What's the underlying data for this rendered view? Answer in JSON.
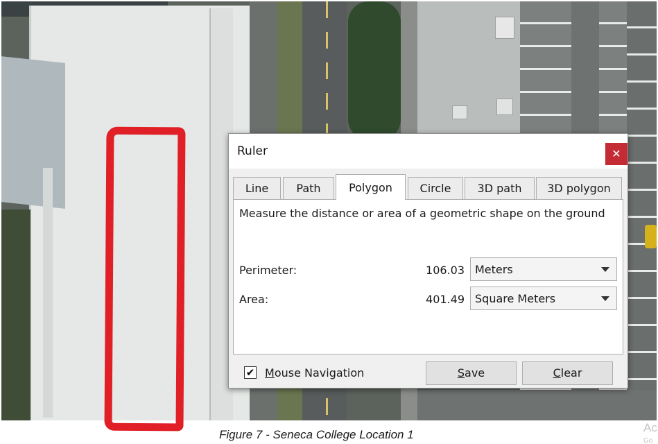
{
  "dialog": {
    "title": "Ruler",
    "close_glyph": "✕"
  },
  "tabs": [
    {
      "label": "Line",
      "active": false
    },
    {
      "label": "Path",
      "active": false
    },
    {
      "label": "Polygon",
      "active": true
    },
    {
      "label": "Circle",
      "active": false
    },
    {
      "label": "3D path",
      "active": false
    },
    {
      "label": "3D polygon",
      "active": false
    }
  ],
  "panel": {
    "description": "Measure the distance or area of a geometric shape on the ground",
    "perimeter": {
      "label": "Perimeter:",
      "value": "106.03",
      "unit": "Meters"
    },
    "area": {
      "label": "Area:",
      "value": "401.49",
      "unit": "Square Meters"
    }
  },
  "footer": {
    "mouse_navigation": {
      "checked": true,
      "check_glyph": "✔",
      "label_first": "M",
      "label_rest": "ouse Navigation"
    },
    "save_button": {
      "first": "S",
      "rest": "ave"
    },
    "clear_button": {
      "first": "C",
      "rest": "lear"
    }
  },
  "caption": "Figure 7 - Seneca College Location 1",
  "watermark": {
    "line1": "Ac",
    "line2": "Go"
  },
  "colors": {
    "polygon_outline": "#e01f26",
    "close_button": "#c42b34"
  },
  "icons": {
    "close": "close-icon",
    "dropdown": "chevron-down-icon",
    "checkbox": "checkmark-icon"
  }
}
